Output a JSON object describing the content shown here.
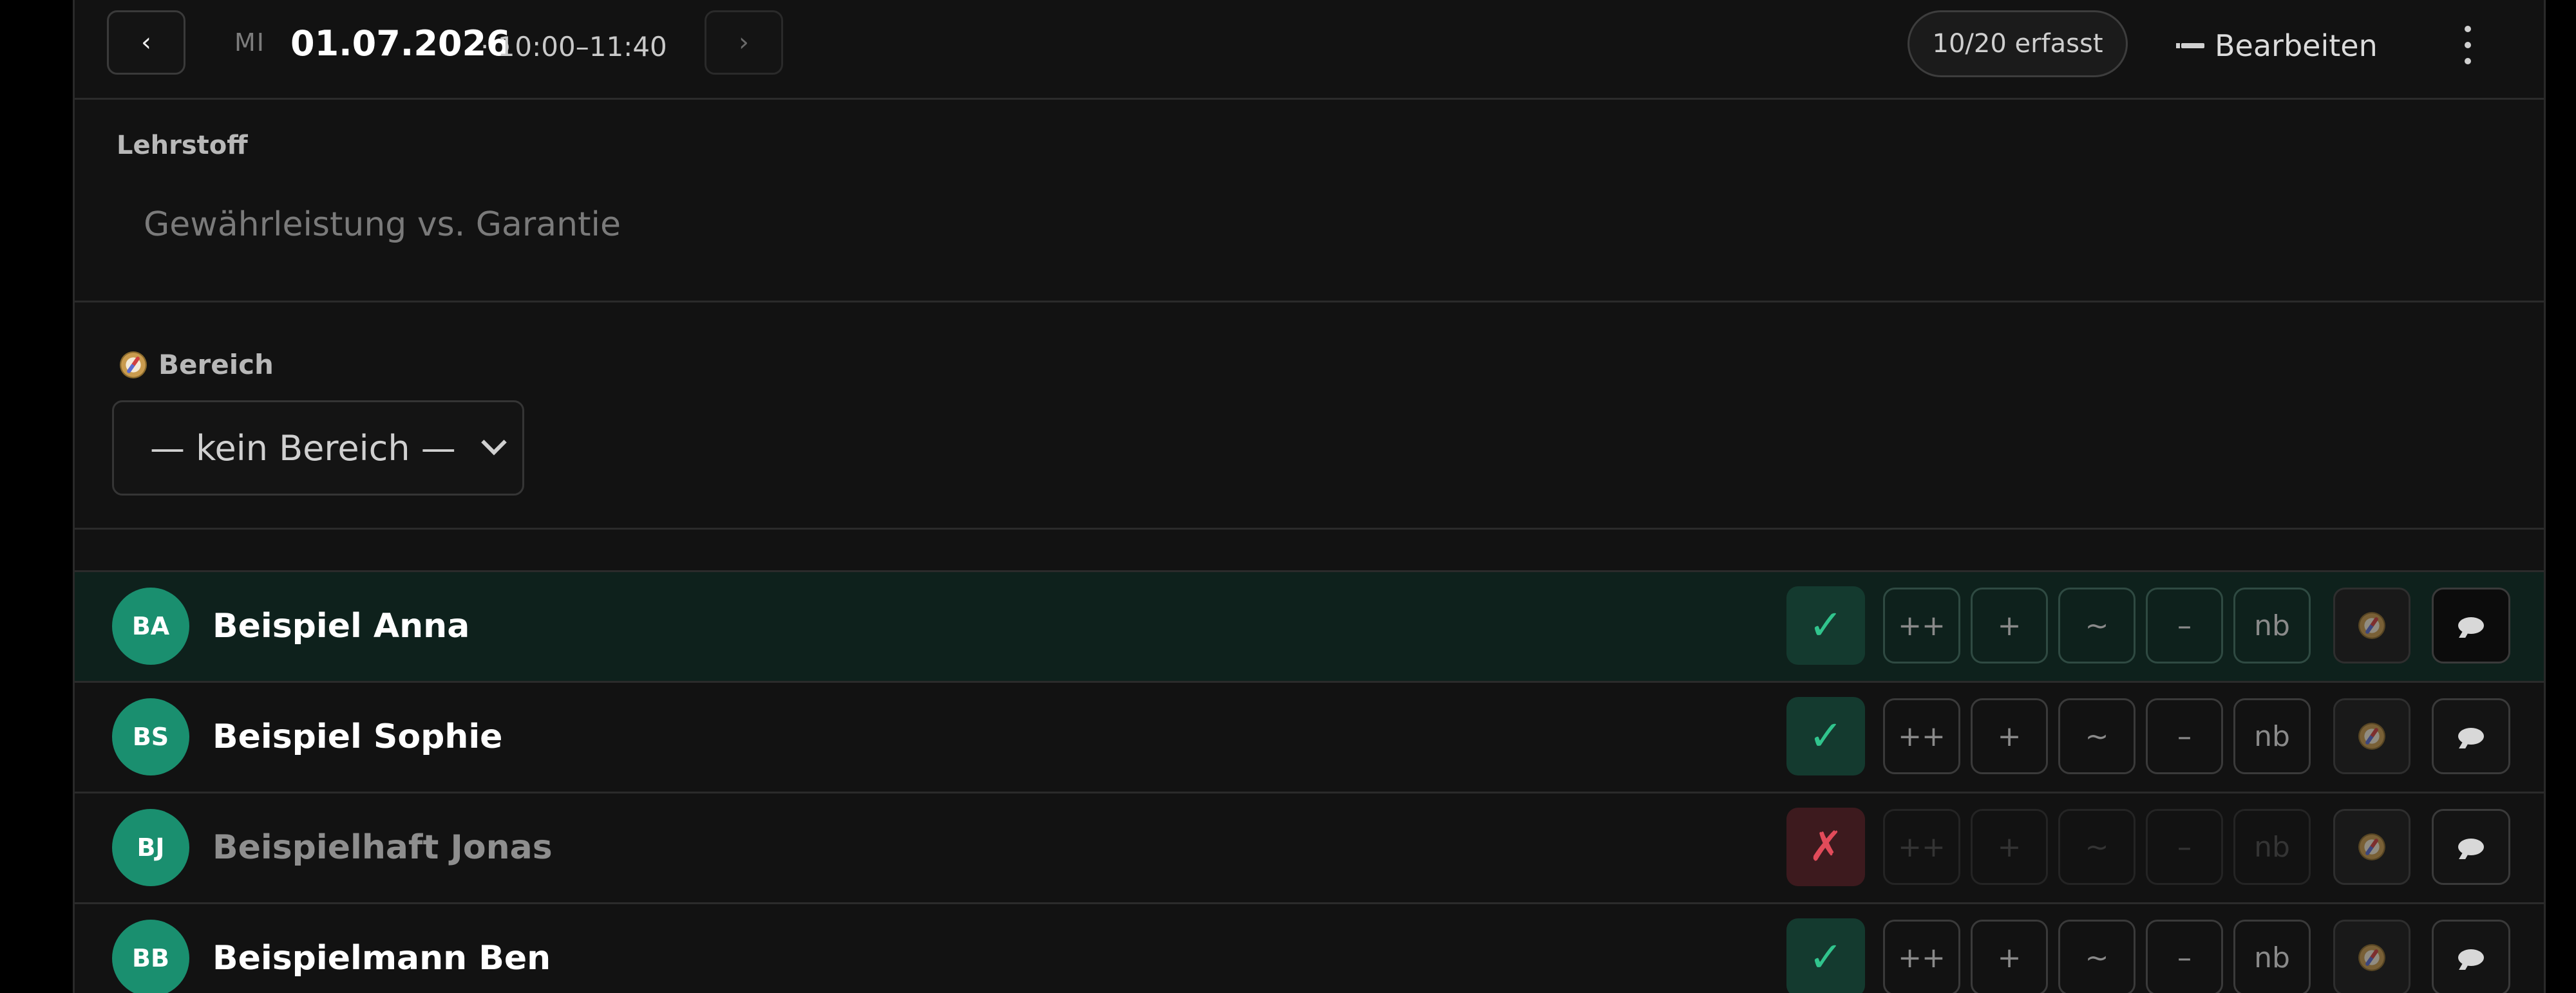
{
  "header": {
    "weekday": "MI",
    "date": "01.07.2026",
    "time_range": "· 10:00–11:40",
    "prev_icon": "chevron-left-icon",
    "next_icon": "chevron-right-icon",
    "recorded_badge": "10/20 erfasst",
    "edit_label": "Bearbeiten",
    "more_icon": "more-vertical-icon"
  },
  "lehrstoff": {
    "label": "Lehrstoff",
    "placeholder": "Gewährleistung vs. Garantie",
    "value": ""
  },
  "bereich": {
    "label": "Bereich",
    "icon": "compass-icon",
    "selected": "— kein Bereich —"
  },
  "grade_options": [
    "++",
    "+",
    "~",
    "–",
    "nb"
  ],
  "students": [
    {
      "initials": "BA",
      "name": "Beispiel Anna",
      "status": "present",
      "status_symbol": "✓",
      "active": true
    },
    {
      "initials": "BS",
      "name": "Beispiel Sophie",
      "status": "present",
      "status_symbol": "✓",
      "active": false
    },
    {
      "initials": "BJ",
      "name": "Beispielhaft Jonas",
      "status": "absent",
      "status_symbol": "✗",
      "active": false
    },
    {
      "initials": "BB",
      "name": "Beispielmann Ben",
      "status": "present",
      "status_symbol": "✓",
      "active": false
    }
  ],
  "colors": {
    "background": "#121212",
    "accent_green": "#1a8f6f",
    "present_check": "#31c48d",
    "absent_cross": "#e24b5a"
  }
}
